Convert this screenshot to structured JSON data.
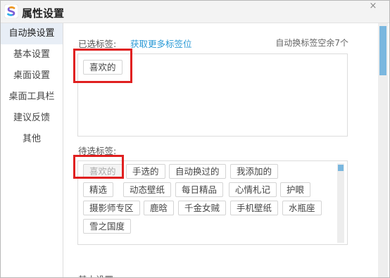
{
  "window": {
    "title": "属性设置",
    "brand_color": "#2b9ad6",
    "highlight_color": "#e02020"
  },
  "sidebar": {
    "items": [
      {
        "label": "自动换设置",
        "active": true
      },
      {
        "label": "基本设置",
        "active": false
      },
      {
        "label": "桌面设置",
        "active": false
      },
      {
        "label": "桌面工具栏",
        "active": false
      },
      {
        "label": "建议反馈",
        "active": false
      },
      {
        "label": "其他",
        "active": false
      }
    ]
  },
  "selected": {
    "label": "已选标签:",
    "more_link": "获取更多标签位",
    "remaining": "自动换标签空余7个",
    "tags": [
      "喜欢的"
    ]
  },
  "candidates": {
    "label": "待选标签:",
    "tags": [
      "喜欢的",
      "手选的",
      "自动换过的",
      "我添加的",
      "精选",
      "动态壁纸",
      "每日精品",
      "心情札记",
      "护眼",
      "摄影师专区",
      "鹿晗",
      "千金女贼",
      "手机壁纸",
      "水瓶座",
      "雪之国度"
    ]
  },
  "basic_settings_label": "基本设置:",
  "icons": {
    "close": "close-icon",
    "logo": "app-logo-icon"
  }
}
